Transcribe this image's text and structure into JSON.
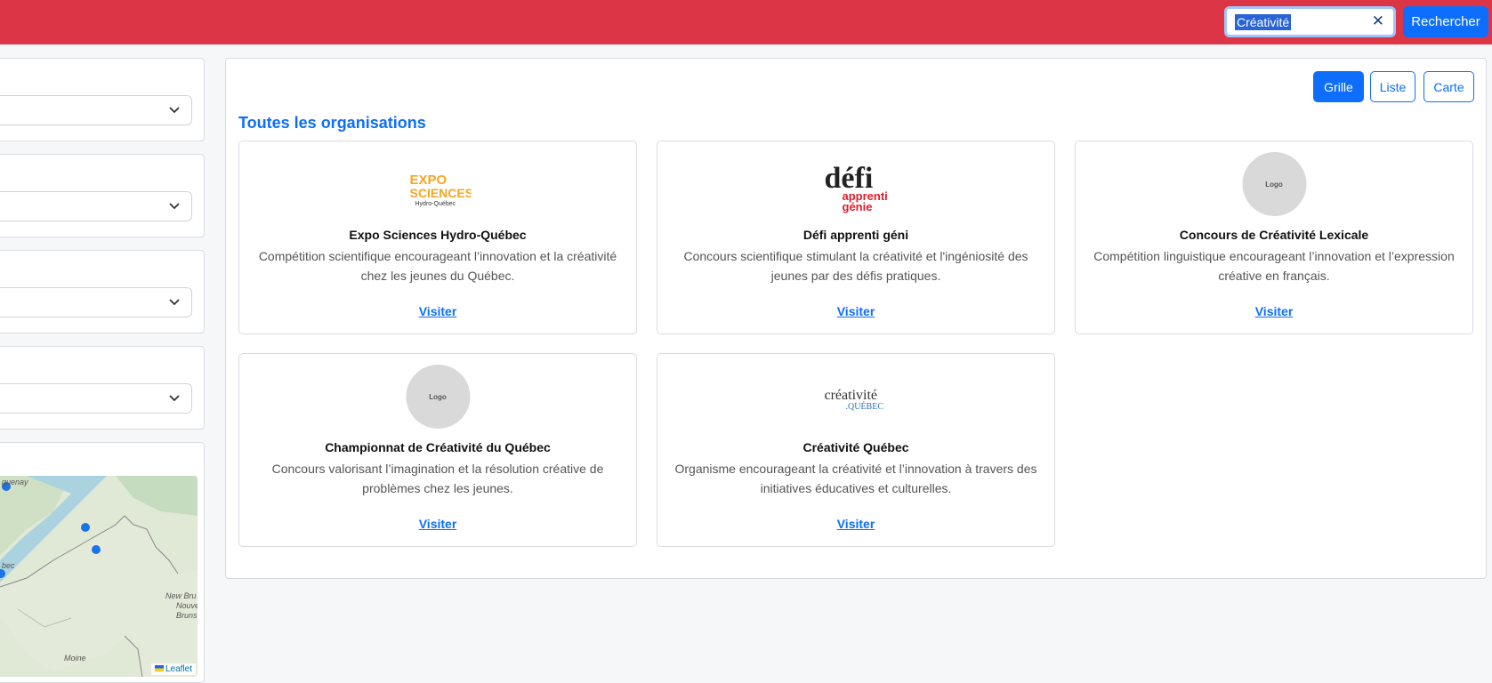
{
  "search": {
    "value": "Créativité",
    "button_label": "Rechercher"
  },
  "views": [
    {
      "label": "Grille",
      "active": true
    },
    {
      "label": "Liste",
      "active": false
    },
    {
      "label": "Carte",
      "active": false
    }
  ],
  "section_title": "Toutes les organisations",
  "organizations": [
    {
      "name": "Expo Sciences Hydro-Québec",
      "description": "Compétition scientifique encourageant l’innovation et la créativité chez les jeunes du Québec.",
      "link": "Visiter",
      "logo": {
        "line1": "EXPO",
        "line2": "SCIENCES",
        "line3": "Hydro-Québec"
      }
    },
    {
      "name": "Défi apprenti géni",
      "description": "Concours scientifique stimulant la créativité et l'ingéniosité des jeunes par des défis pratiques.",
      "link": "Visiter",
      "logo": {
        "line1": "défi",
        "line2": "apprenti",
        "line3": "génie"
      }
    },
    {
      "name": "Concours de Créativité Lexicale",
      "description": "Compétition linguistique encourageant l’innovation et l’expression créative en français.",
      "link": "Visiter",
      "logo": {
        "placeholder": "Logo"
      }
    },
    {
      "name": "Championnat de Créativité du Québec",
      "description": "Concours valorisant l’imagination et la résolution créative de problèmes chez les jeunes.",
      "link": "Visiter",
      "logo": {
        "placeholder": "Logo"
      }
    },
    {
      "name": "Créativité Québec",
      "description": "Organisme encourageant la créativité et l’innovation à travers des initiatives éducatives et culturelles.",
      "link": "Visiter",
      "logo": {
        "line1": "créativité",
        "line2": ".QUÉBEC"
      }
    }
  ],
  "map": {
    "attribution": "Leaflet",
    "labels": {
      "city1": "guenay",
      "city2": "bec",
      "region1": "New Bru",
      "region2": "Nouve",
      "region3": "Bruns",
      "place": "Moine"
    }
  },
  "colors": {
    "header": "#dc3545",
    "primary": "#0d6efd"
  }
}
